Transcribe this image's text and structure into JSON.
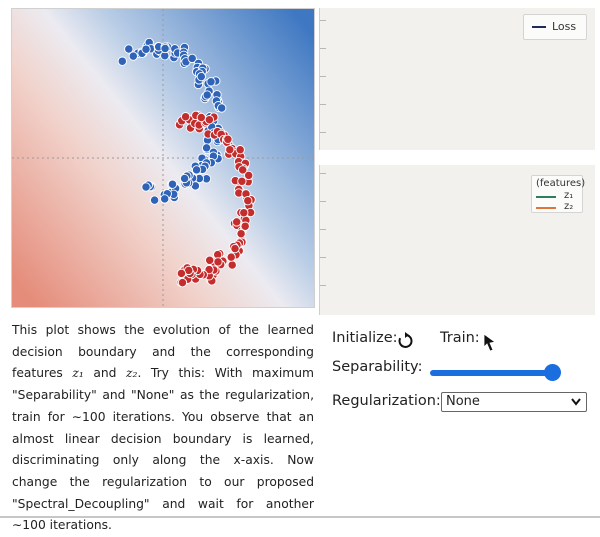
{
  "loss_chart": {
    "legend": "Loss",
    "colors": {
      "loss": "#1f2b5a",
      "background": "#f2f1ee"
    }
  },
  "feature_chart": {
    "legend_title": "(features)",
    "series": [
      {
        "name": "z₁",
        "color": "#2e7d5b"
      },
      {
        "name": "z₂",
        "color": "#e0743a"
      }
    ]
  },
  "scatter": {
    "colors": {
      "class_a": "#2e63b8",
      "class_b": "#c42d2d",
      "boundary_left": "#e58c7a",
      "boundary_right": "#3f78c2"
    }
  },
  "description": {
    "part1": "This plot shows the evolution of the learned decision boundary and the corresponding features ",
    "z1": "z₁",
    "and": " and ",
    "z2": "z₂",
    "part2": ". Try this: With maximum \"Separability\" and \"None\" as the regularization, train for ∼100 iterations. You observe that an almost linear decision boundary is learned, discriminating only along the x-axis. Now change the regularization to our proposed \"Spectral_Decoupling\" and wait for another ∼100 iterations."
  },
  "controls": {
    "initialize_label": "Initialize:",
    "reset_icon": "reset-icon",
    "train_label": "Train:",
    "play_icon": "play-icon",
    "separability_label": "Separability:",
    "separability_value": 1.0,
    "regularization_label": "Regularization:",
    "regularization_value": "None",
    "accent": "#1a6ee0"
  }
}
